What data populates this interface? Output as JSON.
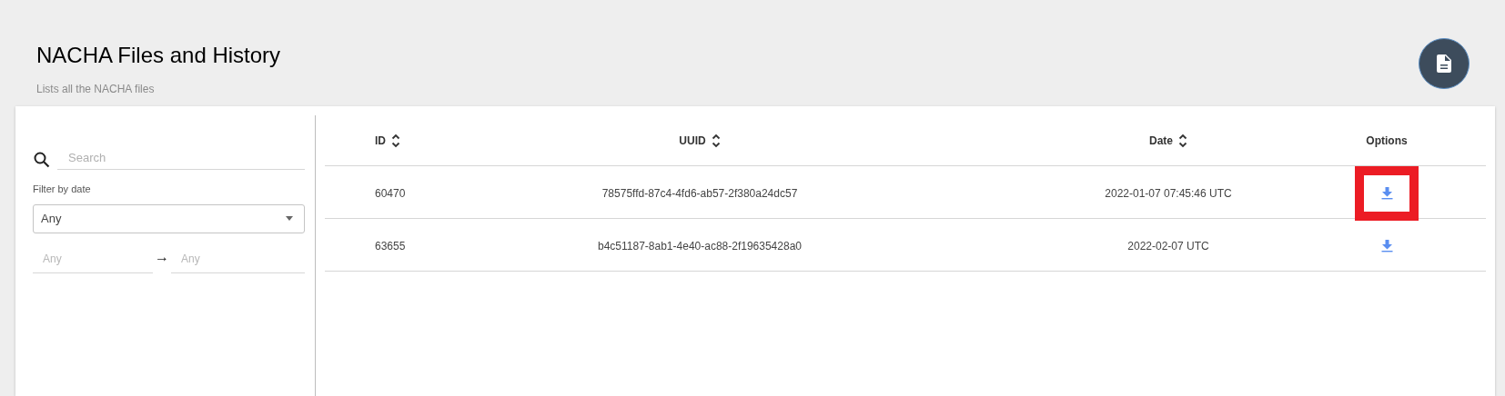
{
  "header": {
    "title": "NACHA Files and History",
    "subtitle": "Lists all the NACHA files"
  },
  "filters": {
    "search": {
      "placeholder": "Search"
    },
    "date_filter": {
      "label": "Filter by date",
      "value": "Any"
    },
    "range": {
      "from_placeholder": "Any",
      "arrow": "→",
      "to_placeholder": "Any"
    }
  },
  "table": {
    "columns": [
      {
        "label": "ID",
        "sortable": true
      },
      {
        "label": "UUID",
        "sortable": true
      },
      {
        "label": "Date",
        "sortable": true
      },
      {
        "label": "Options",
        "sortable": false
      }
    ],
    "rows": [
      {
        "id": "60470",
        "uuid": "78575ffd-87c4-4fd6-ab57-2f380a24dc57",
        "date": "2022-01-07 07:45:46 UTC",
        "highlighted": true
      },
      {
        "id": "63655",
        "uuid": "b4c51187-8ab1-4e40-ac88-2f19635428a0",
        "date": "2022-02-07 UTC",
        "highlighted": false
      }
    ]
  }
}
